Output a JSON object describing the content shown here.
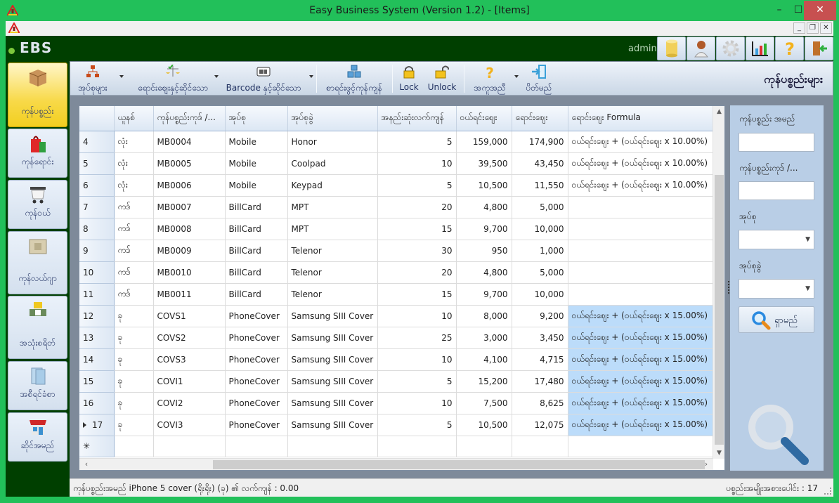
{
  "window": {
    "title": "Easy Business System  (Version 1.2) - [Items]",
    "minimize": "–",
    "maximize": "☐",
    "close": "✕",
    "mdi_minimize": "_",
    "mdi_restore": "❐",
    "mdi_close": "✕"
  },
  "header": {
    "logo": "EBS",
    "user": "admin",
    "buttons": [
      {
        "icon": "database-icon"
      },
      {
        "icon": "user-icon"
      },
      {
        "icon": "settings-gear-icon"
      },
      {
        "icon": "bar-chart-icon"
      },
      {
        "icon": "help-question-icon"
      },
      {
        "icon": "exit-door-icon"
      }
    ],
    "colors": {
      "bar": "#003f00",
      "frame": "#22c05a"
    }
  },
  "nav": {
    "items": [
      {
        "label": "ကုန်ပစ္စည်း",
        "icon": "product-box-icon",
        "active": true
      },
      {
        "label": "ကုန်ရောင်း",
        "icon": "shopping-bag-icon",
        "active": false
      },
      {
        "label": "ကုန်ဝယ်",
        "icon": "shopping-cart-icon",
        "active": false
      },
      {
        "label": "ကုန်လယ်ဂျာ",
        "icon": "ledger-folder-icon",
        "active": false
      },
      {
        "label": "အသုံးစရိတ်",
        "icon": "cash-expense-icon",
        "active": false
      },
      {
        "label": "အစီရင်ခံစာ",
        "icon": "report-book-icon",
        "active": false
      },
      {
        "label": "ဆိုင်အမည်",
        "icon": "shop-store-icon",
        "active": false
      }
    ]
  },
  "toolbar": {
    "categories": "အုပ်စုများ",
    "pricing": "ရောင်းဈေးနှင့်ဆိုင်သော",
    "barcode": "Barcode နှင့်ဆိုင်သော",
    "opening_stock": "စာရင်းဖွင့်ကုန်ကျန်",
    "lock": "Lock",
    "unlock": "Unlock",
    "help": "အကူအညီ",
    "close": "ပိတ်မည်",
    "page_title": "ကုန်ပစ္စည်းများ"
  },
  "grid": {
    "columns": [
      "",
      "ယူနစ်",
      "ကုန်ပစ္စည်းကုဒ် /...",
      "အုပ်စု",
      "အုပ်စုခွဲ",
      "အနည်းဆုံးလက်ကျန်",
      "ဝယ်ရင်းဈေး",
      "ရောင်းဈေး",
      "ရောင်းဈေး Formula"
    ],
    "rows": [
      {
        "no": "4",
        "unit": "လုံး",
        "code": "MB0004",
        "group": "Mobile",
        "subgroup": "Honor",
        "min_stock": "5",
        "cost": "159,000",
        "price": "174,900",
        "formula": "ဝယ်ရင်းဈေး + (ဝယ်ရင်းဈေး x 10.00%)",
        "highlight": false,
        "current": false
      },
      {
        "no": "5",
        "unit": "လုံး",
        "code": "MB0005",
        "group": "Mobile",
        "subgroup": "Coolpad",
        "min_stock": "10",
        "cost": "39,500",
        "price": "43,450",
        "formula": "ဝယ်ရင်းဈေး + (ဝယ်ရင်းဈေး x 10.00%)",
        "highlight": false,
        "current": false
      },
      {
        "no": "6",
        "unit": "လုံး",
        "code": "MB0006",
        "group": "Mobile",
        "subgroup": "Keypad",
        "min_stock": "5",
        "cost": "10,500",
        "price": "11,550",
        "formula": "ဝယ်ရင်းဈေး + (ဝယ်ရင်းဈေး x 10.00%)",
        "highlight": false,
        "current": false
      },
      {
        "no": "7",
        "unit": "ကဒ်",
        "code": "MB0007",
        "group": "BillCard",
        "subgroup": "MPT",
        "min_stock": "20",
        "cost": "4,800",
        "price": "5,000",
        "formula": "",
        "highlight": false,
        "current": false
      },
      {
        "no": "8",
        "unit": "ကဒ်",
        "code": "MB0008",
        "group": "BillCard",
        "subgroup": "MPT",
        "min_stock": "15",
        "cost": "9,700",
        "price": "10,000",
        "formula": "",
        "highlight": false,
        "current": false
      },
      {
        "no": "9",
        "unit": "ကဒ်",
        "code": "MB0009",
        "group": "BillCard",
        "subgroup": "Telenor",
        "min_stock": "30",
        "cost": "950",
        "price": "1,000",
        "formula": "",
        "highlight": false,
        "current": false
      },
      {
        "no": "10",
        "unit": "ကဒ်",
        "code": "MB0010",
        "group": "BillCard",
        "subgroup": "Telenor",
        "min_stock": "20",
        "cost": "4,800",
        "price": "5,000",
        "formula": "",
        "highlight": false,
        "current": false
      },
      {
        "no": "11",
        "unit": "ကဒ်",
        "code": "MB0011",
        "group": "BillCard",
        "subgroup": "Telenor",
        "min_stock": "15",
        "cost": "9,700",
        "price": "10,000",
        "formula": "",
        "highlight": false,
        "current": false
      },
      {
        "no": "12",
        "unit": "ခု",
        "code": "COVS1",
        "group": "PhoneCover",
        "subgroup": "Samsung SIII Cover",
        "min_stock": "10",
        "cost": "8,000",
        "price": "9,200",
        "formula": "ဝယ်ရင်းဈေး + (ဝယ်ရင်းဈေး x 15.00%)",
        "highlight": true,
        "current": false
      },
      {
        "no": "13",
        "unit": "ခု",
        "code": "COVS2",
        "group": "PhoneCover",
        "subgroup": "Samsung SIII Cover",
        "min_stock": "25",
        "cost": "3,000",
        "price": "3,450",
        "formula": "ဝယ်ရင်းဈေး + (ဝယ်ရင်းဈေး x 15.00%)",
        "highlight": true,
        "current": false
      },
      {
        "no": "14",
        "unit": "ခု",
        "code": "COVS3",
        "group": "PhoneCover",
        "subgroup": "Samsung SIII Cover",
        "min_stock": "10",
        "cost": "4,100",
        "price": "4,715",
        "formula": "ဝယ်ရင်းဈေး + (ဝယ်ရင်းဈေး x 15.00%)",
        "highlight": true,
        "current": false
      },
      {
        "no": "15",
        "unit": "ခု",
        "code": "COVI1",
        "group": "PhoneCover",
        "subgroup": "Samsung SIII Cover",
        "min_stock": "5",
        "cost": "15,200",
        "price": "17,480",
        "formula": "ဝယ်ရင်းဈေး + (ဝယ်ရင်းဈေး x 15.00%)",
        "highlight": true,
        "current": false
      },
      {
        "no": "16",
        "unit": "ခု",
        "code": "COVI2",
        "group": "PhoneCover",
        "subgroup": "Samsung SIII Cover",
        "min_stock": "10",
        "cost": "7,500",
        "price": "8,625",
        "formula": "ဝယ်ရင်းဈေး + (ဝယ်ရင်းဈေး x 15.00%)",
        "highlight": true,
        "current": false
      },
      {
        "no": "17",
        "unit": "ခု",
        "code": "COVI3",
        "group": "PhoneCover",
        "subgroup": "Samsung SIII Cover",
        "min_stock": "5",
        "cost": "10,500",
        "price": "12,075",
        "formula": "ဝယ်ရင်းဈေး + (ဝယ်ရင်းဈေး x 15.00%)",
        "highlight": true,
        "current": true
      }
    ],
    "new_row_marker": "✳",
    "highlight_color": "#bcdcfa"
  },
  "search": {
    "name_label": "ကုန်ပစ္စည်း အမည်",
    "name_value": "",
    "code_label": "ကုန်ပစ္စည်းကုဒ် /...",
    "code_value": "",
    "group_label": "အုပ်စု",
    "group_value": "",
    "subgroup_label": "အုပ်စုခွဲ",
    "subgroup_value": "",
    "button_label": "ရှာမည်"
  },
  "status": {
    "left": "ကုန်ပစ္စည်းအမည်  iPhone 5 cover (ရိုးရိုး) (ခု)  ၏ လက်ကျန် : 0.00",
    "right": "ပစ္စည်းအမျိုးအစားပေါင်း : 17"
  }
}
